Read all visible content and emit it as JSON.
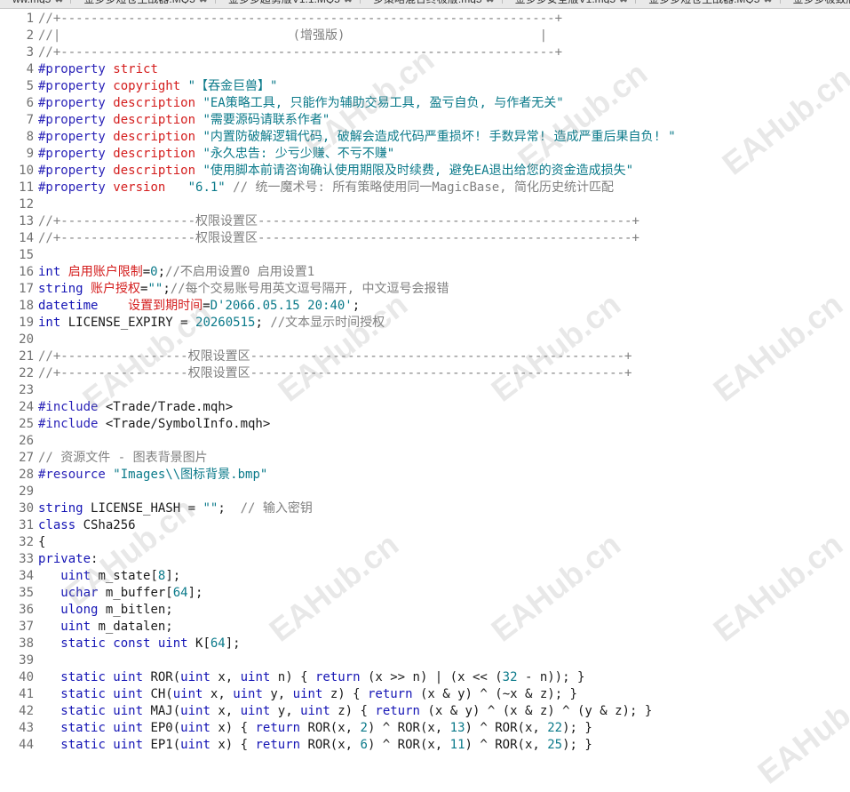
{
  "tabs": [
    {
      "label": "ww.mq5"
    },
    {
      "label": "金多多短仓主战器.MQ5"
    },
    {
      "label": "金多多超勇版V1.1.MQ5"
    },
    {
      "label": "多策略混合终极版.mq5"
    },
    {
      "label": "金多多安全版V1.mq5"
    },
    {
      "label": "金多多短仓主战器.MQ5"
    },
    {
      "label": "金多多极致版.m"
    }
  ],
  "close_glyph": "✖",
  "watermark": "EAHub.cn",
  "lines": [
    {
      "n": "1",
      "parts": [
        [
          "cm",
          "//+------------------------------------------------------------------+"
        ]
      ]
    },
    {
      "n": "2",
      "parts": [
        [
          "cm",
          "//|                               (增强版)                          |"
        ]
      ]
    },
    {
      "n": "3",
      "parts": [
        [
          "cm",
          "//+------------------------------------------------------------------+"
        ]
      ]
    },
    {
      "n": "4",
      "parts": [
        [
          "pp",
          "#property "
        ],
        [
          "prop",
          "strict"
        ]
      ]
    },
    {
      "n": "5",
      "parts": [
        [
          "pp",
          "#property "
        ],
        [
          "prop",
          "copyright "
        ],
        [
          "str",
          "\"【吞金巨兽】\""
        ]
      ]
    },
    {
      "n": "6",
      "parts": [
        [
          "pp",
          "#property "
        ],
        [
          "prop",
          "description "
        ],
        [
          "str",
          "\"EA策略工具, 只能作为辅助交易工具, 盈亏自负, 与作者无关\""
        ]
      ]
    },
    {
      "n": "7",
      "parts": [
        [
          "pp",
          "#property "
        ],
        [
          "prop",
          "description "
        ],
        [
          "str",
          "\"需要源码请联系作者\""
        ]
      ]
    },
    {
      "n": "8",
      "parts": [
        [
          "pp",
          "#property "
        ],
        [
          "prop",
          "description "
        ],
        [
          "str",
          "\"内置防破解逻辑代码, 破解会造成代码严重损坏! 手数异常! 造成严重后果自负! \""
        ]
      ]
    },
    {
      "n": "9",
      "parts": [
        [
          "pp",
          "#property "
        ],
        [
          "prop",
          "description "
        ],
        [
          "str",
          "\"永久忠告: 少亏少赚、不亏不赚\""
        ]
      ]
    },
    {
      "n": "10",
      "parts": [
        [
          "pp",
          "#property "
        ],
        [
          "prop",
          "description "
        ],
        [
          "str",
          "\"使用脚本前请咨询确认使用期限及时续费, 避免EA退出给您的资金造成损失\""
        ]
      ]
    },
    {
      "n": "11",
      "parts": [
        [
          "pp",
          "#property "
        ],
        [
          "prop",
          "version   "
        ],
        [
          "str",
          "\"6.1\""
        ],
        [
          "cm",
          " // 统一魔术号: 所有策略使用同一MagicBase, 简化历史统计匹配"
        ]
      ]
    },
    {
      "n": "12",
      "parts": []
    },
    {
      "n": "13",
      "parts": [
        [
          "cm",
          "//+------------------权限设置区--------------------------------------------------+"
        ]
      ]
    },
    {
      "n": "14",
      "parts": [
        [
          "cm",
          "//+------------------权限设置区--------------------------------------------------+"
        ]
      ]
    },
    {
      "n": "15",
      "parts": []
    },
    {
      "n": "16",
      "parts": [
        [
          "kw",
          "int "
        ],
        [
          "var",
          "启用账户限制"
        ],
        [
          "",
          "="
        ],
        [
          "num",
          "0"
        ],
        [
          "",
          ";"
        ],
        [
          "cm",
          "//不启用设置0 启用设置1"
        ]
      ]
    },
    {
      "n": "17",
      "parts": [
        [
          "kw",
          "string "
        ],
        [
          "var",
          "账户授权"
        ],
        [
          "",
          "="
        ],
        [
          "str",
          "\"\""
        ],
        [
          "",
          ";"
        ],
        [
          "cm",
          "//每个交易账号用英文逗号隔开, 中文逗号会报错"
        ]
      ]
    },
    {
      "n": "18",
      "parts": [
        [
          "kw",
          "datetime    "
        ],
        [
          "var",
          "设置到期时间"
        ],
        [
          "",
          "="
        ],
        [
          "str",
          "D'2066.05.15 20:40'"
        ],
        [
          "",
          ";"
        ]
      ]
    },
    {
      "n": "19",
      "parts": [
        [
          "kw",
          "int "
        ],
        [
          "",
          "LICENSE_EXPIRY = "
        ],
        [
          "num",
          "20260515"
        ],
        [
          "",
          "; "
        ],
        [
          "cm",
          "//文本显示时间授权"
        ]
      ]
    },
    {
      "n": "20",
      "parts": []
    },
    {
      "n": "21",
      "parts": [
        [
          "cm",
          "//+-----------------权限设置区--------------------------------------------------+"
        ]
      ]
    },
    {
      "n": "22",
      "parts": [
        [
          "cm",
          "//+-----------------权限设置区--------------------------------------------------+"
        ]
      ]
    },
    {
      "n": "23",
      "parts": []
    },
    {
      "n": "24",
      "parts": [
        [
          "pp",
          "#include "
        ],
        [
          "",
          "<Trade/Trade.mqh>"
        ]
      ]
    },
    {
      "n": "25",
      "parts": [
        [
          "pp",
          "#include "
        ],
        [
          "",
          "<Trade/SymbolInfo.mqh>"
        ]
      ]
    },
    {
      "n": "26",
      "parts": []
    },
    {
      "n": "27",
      "parts": [
        [
          "cm",
          "// 资源文件 - 图表背景图片"
        ]
      ]
    },
    {
      "n": "28",
      "parts": [
        [
          "pp",
          "#resource "
        ],
        [
          "str",
          "\"Images\\\\图标背景.bmp\""
        ]
      ]
    },
    {
      "n": "29",
      "parts": []
    },
    {
      "n": "30",
      "parts": [
        [
          "kw",
          "string "
        ],
        [
          "",
          "LICENSE_HASH = "
        ],
        [
          "str",
          "\"\""
        ],
        [
          "",
          ";  "
        ],
        [
          "cm",
          "// 输入密钥"
        ]
      ]
    },
    {
      "n": "31",
      "parts": [
        [
          "kw",
          "class "
        ],
        [
          "",
          "CSha256"
        ]
      ]
    },
    {
      "n": "32",
      "parts": [
        [
          "",
          "{"
        ]
      ]
    },
    {
      "n": "33",
      "parts": [
        [
          "kw",
          "private"
        ],
        [
          "",
          ":"
        ]
      ]
    },
    {
      "n": "34",
      "parts": [
        [
          "",
          "   "
        ],
        [
          "kw",
          "uint "
        ],
        [
          "",
          "m_state["
        ],
        [
          "num",
          "8"
        ],
        [
          "",
          "];"
        ]
      ]
    },
    {
      "n": "35",
      "parts": [
        [
          "",
          "   "
        ],
        [
          "kw",
          "uchar "
        ],
        [
          "",
          "m_buffer["
        ],
        [
          "num",
          "64"
        ],
        [
          "",
          "];"
        ]
      ]
    },
    {
      "n": "36",
      "parts": [
        [
          "",
          "   "
        ],
        [
          "kw",
          "ulong "
        ],
        [
          "",
          "m_bitlen;"
        ]
      ]
    },
    {
      "n": "37",
      "parts": [
        [
          "",
          "   "
        ],
        [
          "kw",
          "uint "
        ],
        [
          "",
          "m_datalen;"
        ]
      ]
    },
    {
      "n": "38",
      "parts": [
        [
          "",
          "   "
        ],
        [
          "kw",
          "static const uint "
        ],
        [
          "",
          "K["
        ],
        [
          "num",
          "64"
        ],
        [
          "",
          "];"
        ]
      ]
    },
    {
      "n": "39",
      "parts": []
    },
    {
      "n": "40",
      "parts": [
        [
          "",
          "   "
        ],
        [
          "kw",
          "static uint "
        ],
        [
          "",
          "ROR("
        ],
        [
          "kw",
          "uint "
        ],
        [
          "",
          "x, "
        ],
        [
          "kw",
          "uint "
        ],
        [
          "",
          "n) { "
        ],
        [
          "kw",
          "return "
        ],
        [
          "",
          "(x >> n) | (x << ("
        ],
        [
          "num",
          "32"
        ],
        [
          "",
          " - n)); }"
        ]
      ]
    },
    {
      "n": "41",
      "parts": [
        [
          "",
          "   "
        ],
        [
          "kw",
          "static uint "
        ],
        [
          "",
          "CH("
        ],
        [
          "kw",
          "uint "
        ],
        [
          "",
          "x, "
        ],
        [
          "kw",
          "uint "
        ],
        [
          "",
          "y, "
        ],
        [
          "kw",
          "uint "
        ],
        [
          "",
          "z) { "
        ],
        [
          "kw",
          "return "
        ],
        [
          "",
          "(x & y) ^ (~x & z); }"
        ]
      ]
    },
    {
      "n": "42",
      "parts": [
        [
          "",
          "   "
        ],
        [
          "kw",
          "static uint "
        ],
        [
          "",
          "MAJ("
        ],
        [
          "kw",
          "uint "
        ],
        [
          "",
          "x, "
        ],
        [
          "kw",
          "uint "
        ],
        [
          "",
          "y, "
        ],
        [
          "kw",
          "uint "
        ],
        [
          "",
          "z) { "
        ],
        [
          "kw",
          "return "
        ],
        [
          "",
          "(x & y) ^ (x & z) ^ (y & z); }"
        ]
      ]
    },
    {
      "n": "43",
      "parts": [
        [
          "",
          "   "
        ],
        [
          "kw",
          "static uint "
        ],
        [
          "",
          "EP0("
        ],
        [
          "kw",
          "uint "
        ],
        [
          "",
          "x) { "
        ],
        [
          "kw",
          "return "
        ],
        [
          "",
          "ROR(x, "
        ],
        [
          "num",
          "2"
        ],
        [
          "",
          ") ^ ROR(x, "
        ],
        [
          "num",
          "13"
        ],
        [
          "",
          ") ^ ROR(x, "
        ],
        [
          "num",
          "22"
        ],
        [
          "",
          "); }"
        ]
      ]
    },
    {
      "n": "44",
      "parts": [
        [
          "",
          "   "
        ],
        [
          "kw",
          "static uint "
        ],
        [
          "",
          "EP1("
        ],
        [
          "kw",
          "uint "
        ],
        [
          "",
          "x) { "
        ],
        [
          "kw",
          "return "
        ],
        [
          "",
          "ROR(x, "
        ],
        [
          "num",
          "6"
        ],
        [
          "",
          ") ^ ROR(x, "
        ],
        [
          "num",
          "11"
        ],
        [
          "",
          ") ^ ROR(x, "
        ],
        [
          "num",
          "25"
        ],
        [
          "",
          "); }"
        ]
      ]
    }
  ]
}
